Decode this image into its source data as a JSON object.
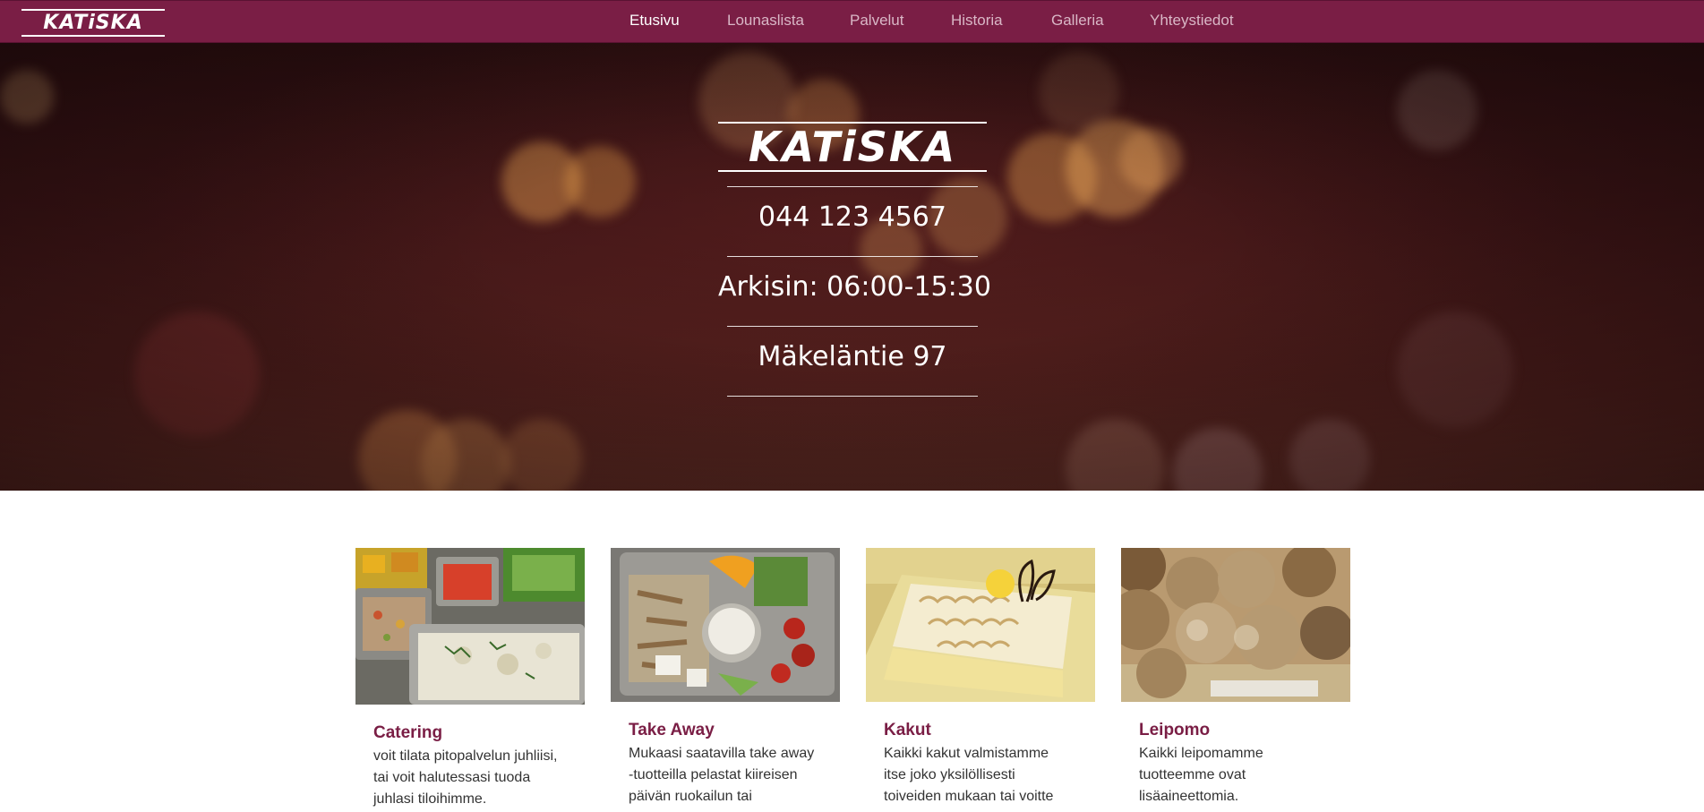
{
  "brand": {
    "name": "KATiSKA"
  },
  "colors": {
    "accent": "#7a1e45",
    "nav_inactive": "#d9b7c6",
    "white": "#ffffff"
  },
  "nav": {
    "items": [
      {
        "label": "Etusivu",
        "active": true
      },
      {
        "label": "Lounaslista",
        "active": false
      },
      {
        "label": "Palvelut",
        "active": false
      },
      {
        "label": "Historia",
        "active": false
      },
      {
        "label": "Galleria",
        "active": false
      },
      {
        "label": "Yhteystiedot",
        "active": false
      }
    ]
  },
  "hero": {
    "logo": "KATiSKA",
    "phone": "044 123 4567",
    "hours": "Arkisin: 06:00-15:30",
    "address": "Mäkeläntie 97"
  },
  "cards": [
    {
      "title": "Catering",
      "text": "voit tilata pitopalvelun juhliisi, tai voit halutessasi tuoda juhlasi tiloihimme.",
      "image": "salad-buffet-photo"
    },
    {
      "title": "Take Away",
      "text": "Mukaasi saatavilla take away -tuotteilla pelastat kiireisen päivän ruokailun tai",
      "image": "take-away-box-photo"
    },
    {
      "title": "Kakut",
      "text": "Kaikki kakut valmistamme itse joko yksilöllisesti toiveiden mukaan tai voitte",
      "image": "meringue-cake-photo"
    },
    {
      "title": "Leipomo",
      "text": "Kaikki leipomamme tuotteemme ovat lisäaineettomia.",
      "image": "bread-rolls-photo"
    }
  ]
}
